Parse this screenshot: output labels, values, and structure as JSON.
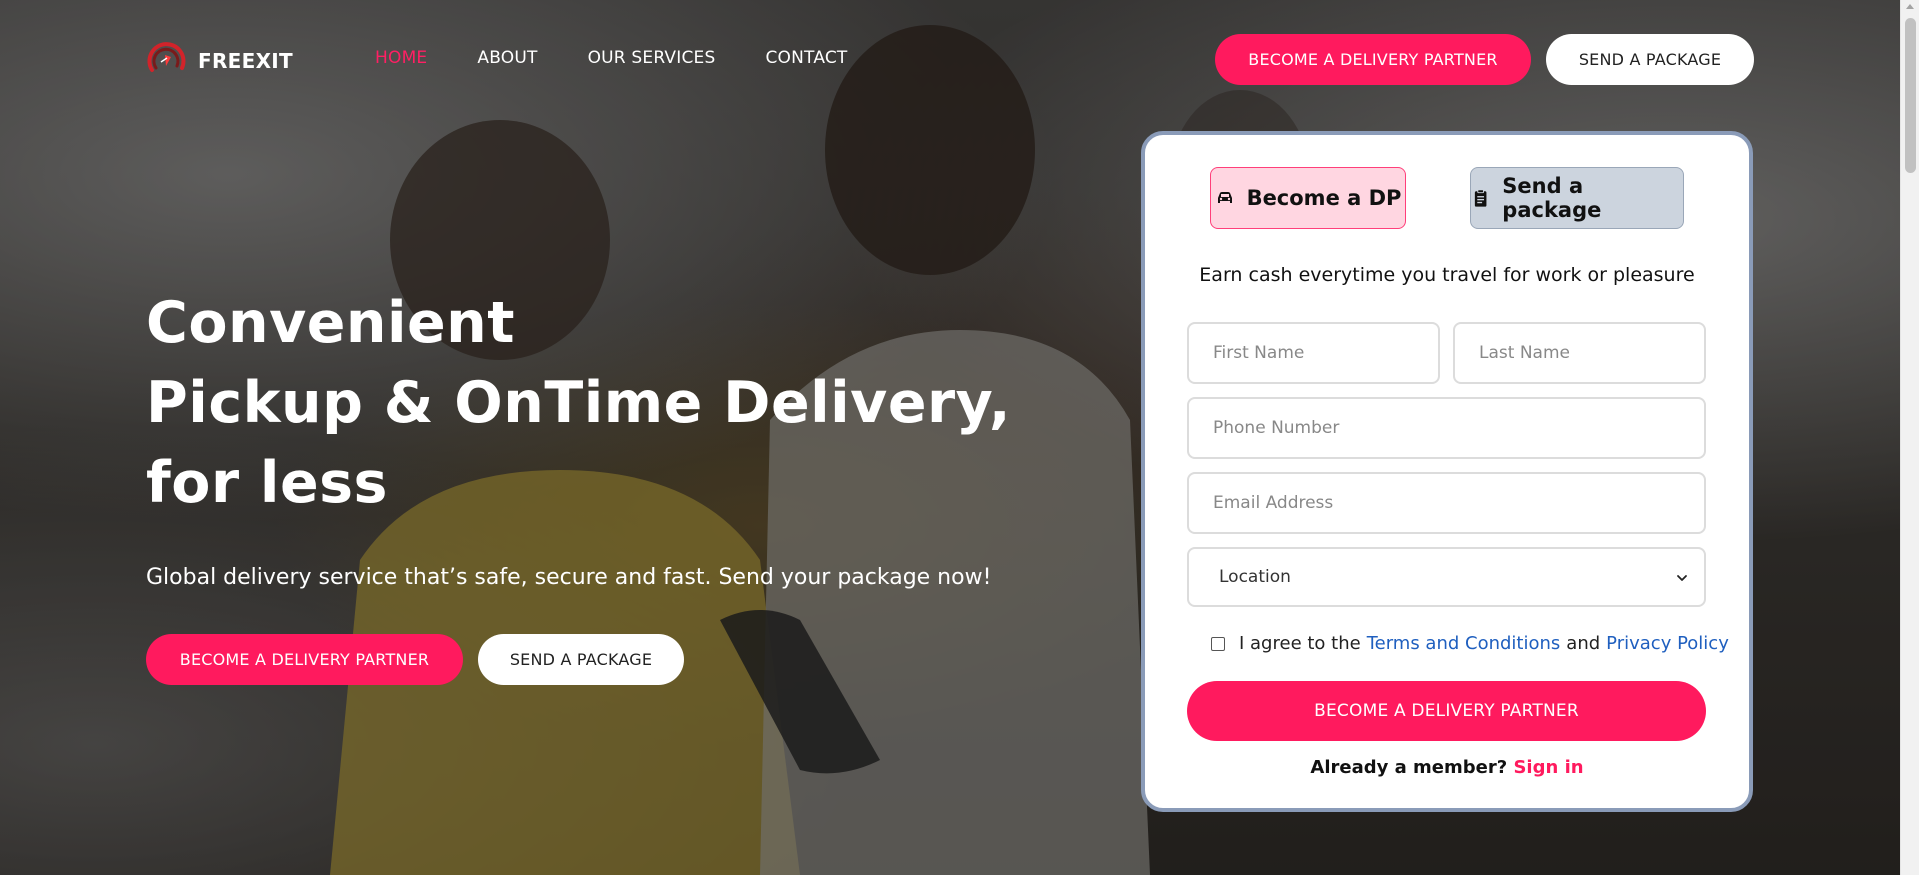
{
  "nav": {
    "logo_text": "FREEXIT",
    "links": [
      {
        "label": "HOME",
        "active": true
      },
      {
        "label": "ABOUT",
        "active": false
      },
      {
        "label": "OUR SERVICES",
        "active": false
      },
      {
        "label": "CONTACT",
        "active": false
      }
    ],
    "cta_partner": "BECOME A DELIVERY PARTNER",
    "cta_send": "SEND A PACKAGE"
  },
  "hero": {
    "title_line1": "Convenient",
    "title_line2": "Pickup & OnTime Delivery,",
    "title_line3": "for less",
    "subtitle": "Global delivery service that’s safe, secure and fast. Send your package now!",
    "btn_partner": "BECOME A DELIVERY PARTNER",
    "btn_send": "SEND A PACKAGE"
  },
  "form": {
    "tab_dp": {
      "label": "Become a DP",
      "icon": "car-icon"
    },
    "tab_package": {
      "label": "Send a package",
      "icon": "clipboard-icon"
    },
    "tagline": "Earn cash everytime you travel for work or pleasure",
    "first_name": {
      "value": "",
      "placeholder": "First Name"
    },
    "last_name": {
      "value": "",
      "placeholder": "Last Name"
    },
    "phone": {
      "value": "",
      "placeholder": "Phone Number"
    },
    "email": {
      "value": "",
      "placeholder": "Email Address"
    },
    "location": {
      "selected": "Location"
    },
    "agree": {
      "prefix": "I agree to the",
      "terms": "Terms and Conditions",
      "and": "and",
      "privacy": "Privacy Policy",
      "checked": false
    },
    "submit": "BECOME A DELIVERY PARTNER",
    "member_text": "Already a member?",
    "signin": "Sign in"
  },
  "colors": {
    "accent": "#ff1a5e",
    "link": "#1f5fbf",
    "card_border": "#8a9bb8",
    "tab_dp_bg": "#ffd6e1",
    "tab_package_bg": "#ccd4de"
  }
}
